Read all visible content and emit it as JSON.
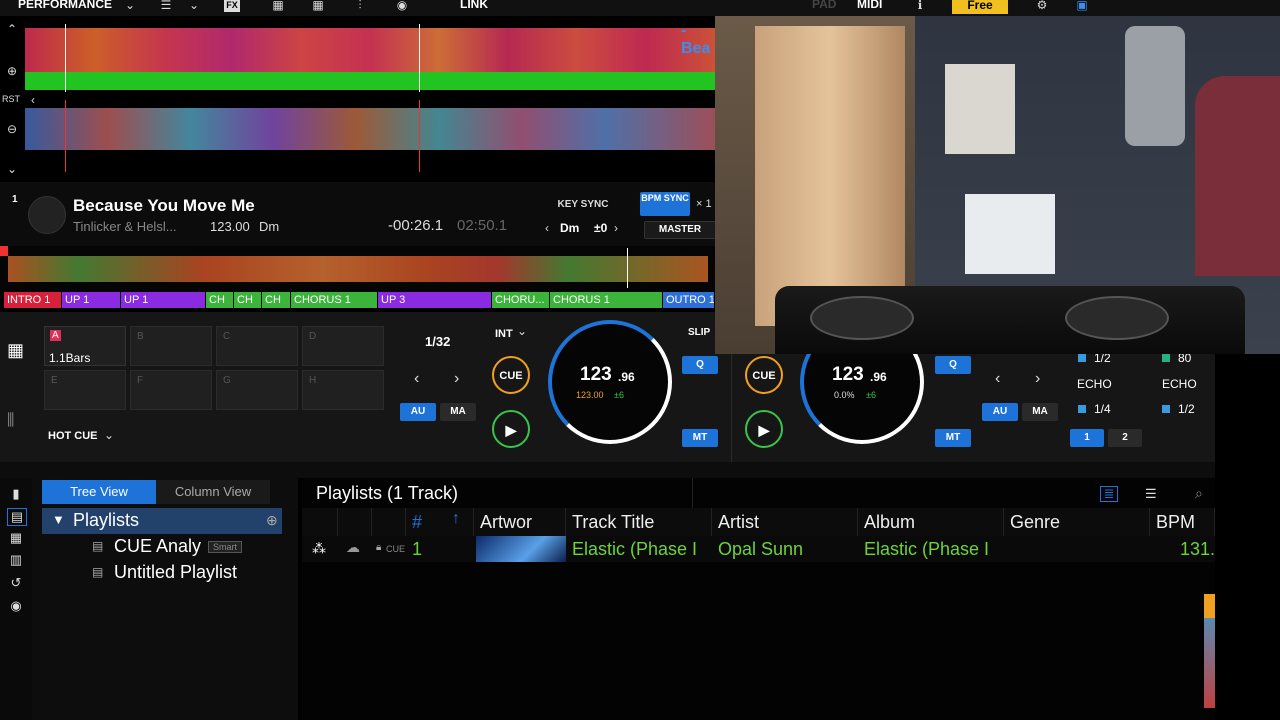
{
  "topbar": {
    "mode": "PERFORMANCE",
    "link": "LINK",
    "pad": "PAD",
    "midi": "MIDI",
    "plan": "Free"
  },
  "waveform": {
    "deck_label": "-Bea",
    "rst": "RST"
  },
  "deck1": {
    "number": "1",
    "title": "Because You Move Me",
    "artist": "Tinlicker & Helsl...",
    "bpm": "123.00",
    "key": "Dm",
    "remaining": "-00:26.1",
    "total": "02:50.1",
    "key_sync": "KEY SYNC",
    "bpm_sync": "BPM SYNC",
    "master": "MASTER",
    "key_display": "Dm",
    "key_shift": "±0",
    "close": "× 1"
  },
  "phrases": [
    {
      "label": "INTRO 1",
      "color": "#d8203a"
    },
    {
      "label": "UP 1",
      "color": "#8a2be2"
    },
    {
      "label": "UP 1",
      "color": "#8a2be2"
    },
    {
      "label": "CH",
      "color": "#3cb43c"
    },
    {
      "label": "CH",
      "color": "#3cb43c"
    },
    {
      "label": "CH",
      "color": "#3cb43c"
    },
    {
      "label": "CHORUS 1",
      "color": "#3cb43c"
    },
    {
      "label": "UP 3",
      "color": "#8a2be2"
    },
    {
      "label": "CHORU...",
      "color": "#3cb43c"
    },
    {
      "label": "CHORUS 1",
      "color": "#3cb43c"
    },
    {
      "label": "OUTRO 1",
      "color": "#2f6fd8"
    }
  ],
  "perf": {
    "pad_a_value": "1.1Bars",
    "pad_letters": [
      "A",
      "B",
      "C",
      "D",
      "E",
      "F",
      "G",
      "H"
    ],
    "hot_cue": "HOT CUE",
    "beat_jump": "1/32",
    "int": "INT",
    "slip": "SLIP",
    "cue": "CUE",
    "au": "AU",
    "ma": "MA",
    "q": "Q",
    "mt": "MT",
    "jog1_bpm_main": "123",
    "jog1_bpm_dec": ".96",
    "jog1_sub": "123.00",
    "jog1_pitch": "±6",
    "jog2_bpm_main": "123",
    "jog2_bpm_dec": ".96",
    "jog2_sub": "0.0%",
    "jog2_pitch": "±6",
    "fx_rows": [
      {
        "left": "1/2",
        "right": "80"
      },
      {
        "left": "ECHO",
        "right": "ECHO"
      },
      {
        "left": "1/4",
        "right": "1/2"
      }
    ],
    "fx_btn1": "1",
    "fx_btn2": "2"
  },
  "browser": {
    "tree_view": "Tree View",
    "column_view": "Column View",
    "playlists_root": "Playlists",
    "items": [
      "CUE Analy",
      "Untitled Playlist"
    ],
    "smart_badge": "Smart",
    "list_title": "Playlists (1 Track)",
    "columns": [
      "#",
      "Artwor",
      "Track Title",
      "Artist",
      "Album",
      "Genre",
      "BPM"
    ],
    "row": {
      "num": "1",
      "title": "Elastic (Phase I",
      "artist": "Opal Sunn",
      "album": "Elastic (Phase I",
      "genre": "",
      "bpm": "131.",
      "cue_tag": "CUE"
    }
  },
  "colors": {
    "accent_blue": "#1e73d8",
    "green_text": "#6cd43a",
    "cue_orange": "#f0a020",
    "play_green": "#39c44a",
    "free_yellow": "#f0c020"
  }
}
